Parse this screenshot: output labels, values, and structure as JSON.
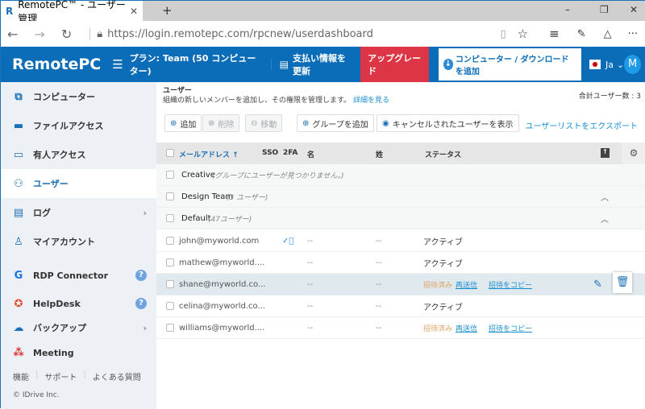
{
  "browser": {
    "tab_title": "RemotePC™ - ユーザー管理",
    "url": "https://login.remotepc.com/rpcnew/userdashboard"
  },
  "header": {
    "logo": "RemotePC",
    "plan": "プラン: Team (50 コンピューター)",
    "billing": "支払い情報を更新",
    "upgrade": "アップグレード",
    "add_download": "コンピューター / ダウンロード を追加",
    "lang": "Ja",
    "avatar": "M",
    "accent": "#0b6db8",
    "upgrade_color": "#dc3545"
  },
  "sidebar": {
    "items": [
      {
        "label": "コンピューター",
        "icon": "computers-icon"
      },
      {
        "label": "ファイルアクセス",
        "icon": "file-access-icon"
      },
      {
        "label": "有人アクセス",
        "icon": "attended-access-icon"
      },
      {
        "label": "ユーザー",
        "icon": "users-icon",
        "active": true
      },
      {
        "label": "ログ",
        "icon": "logs-icon"
      },
      {
        "label": "マイアカウント",
        "icon": "account-icon"
      },
      {
        "label": "RDP Connector",
        "icon": "rdp-icon"
      },
      {
        "label": "HelpDesk",
        "icon": "helpdesk-icon"
      },
      {
        "label": "バックアップ",
        "icon": "backup-icon"
      },
      {
        "label": "Meeting",
        "icon": "meeting-icon"
      }
    ],
    "footer_links": [
      "機能",
      "サポート",
      "よくある質問"
    ],
    "copyright": "© IDrive Inc."
  },
  "main": {
    "title": "ユーザー",
    "description": "組織の新しいメンバーを追加し、その権限を管理します。",
    "learn_more": "詳細を見る",
    "total_users": "合計ユーザー数 : 3",
    "toolbar": {
      "add": "追加",
      "delete": "削除",
      "move": "移動",
      "add_group": "グループを追加",
      "show_cancelled": "キャンセルされたユーザーを表示",
      "export": "ユーザーリストをエクスポート"
    },
    "columns": {
      "email": "メールアドレス ↑",
      "sso": "SSO",
      "twofa": "2FA",
      "first": "名",
      "last": "姓",
      "status": "ステータス"
    },
    "groups": [
      {
        "name": "Creative",
        "note": "(グループにユーザーが見つかりません。)"
      },
      {
        "name": "Design Team",
        "note": "(3 ユーザー)"
      },
      {
        "name": "Default",
        "note": "(47ユーザー)"
      }
    ],
    "users": [
      {
        "email": "john@myworld.com",
        "twofa": true,
        "first": "--",
        "last": "--",
        "status": "アクティブ"
      },
      {
        "email": "mathew@myworld....",
        "first": "--",
        "last": "--",
        "status": "アクティブ"
      },
      {
        "email": "shane@myworld.co...",
        "first": "--",
        "last": "--",
        "status": "招待済み",
        "resend": "再送信",
        "copy": "招待をコピー",
        "highlighted": true
      },
      {
        "email": "celina@myworld.co...",
        "first": "--",
        "last": "--",
        "status": "アクティブ"
      },
      {
        "email": "williams@myworld....",
        "first": "--",
        "last": "--",
        "status": "招待済み",
        "resend": "再送信",
        "copy": "招待をコピー"
      }
    ]
  }
}
